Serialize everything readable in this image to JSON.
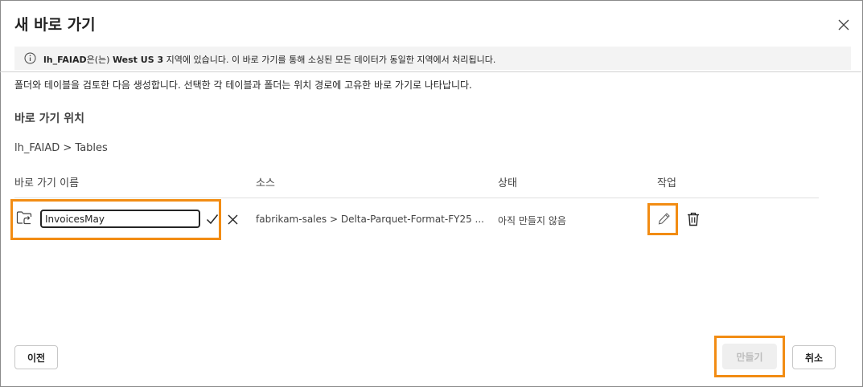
{
  "dialog": {
    "title": "새 바로 가기",
    "info": {
      "name": "lh_FAIAD",
      "mid1": "은(는) ",
      "region": "West US 3",
      "rest": " 지역에 있습니다. 이 바로 가기를 통해 소싱된 모든 데이터가 동일한 지역에서 처리됩니다."
    },
    "description": "폴더와 테이블을 검토한 다음 생성합니다. 선택한 각 테이블과 폴더는 위치 경로에 고유한 바로 가기로 나타납니다.",
    "section_title": "바로 가기 위치",
    "breadcrumb": "lh_FAIAD > Tables"
  },
  "table": {
    "headers": {
      "name": "바로 가기 이름",
      "source": "소스",
      "status": "상태",
      "actions": "작업"
    },
    "rows": [
      {
        "name_value": "InvoicesMay",
        "source": "fabrikam-sales > Delta-Parquet-Format-FY25 ...",
        "status": "아직 만들지 않음"
      }
    ]
  },
  "footer": {
    "prev_label": "이전",
    "create_label": "만들기",
    "cancel_label": "취소"
  },
  "icons": {
    "close": "close-icon",
    "info": "info-icon",
    "folder": "folder-shortcut-icon",
    "check": "checkmark-icon",
    "dismiss": "dismiss-icon",
    "edit": "pencil-icon",
    "delete": "trash-icon"
  },
  "colors": {
    "highlight": "#f28c13",
    "info_bar_bg": "#f3f3f3",
    "disabled_button_bg": "#efefef",
    "disabled_text": "#bdbdbd"
  }
}
